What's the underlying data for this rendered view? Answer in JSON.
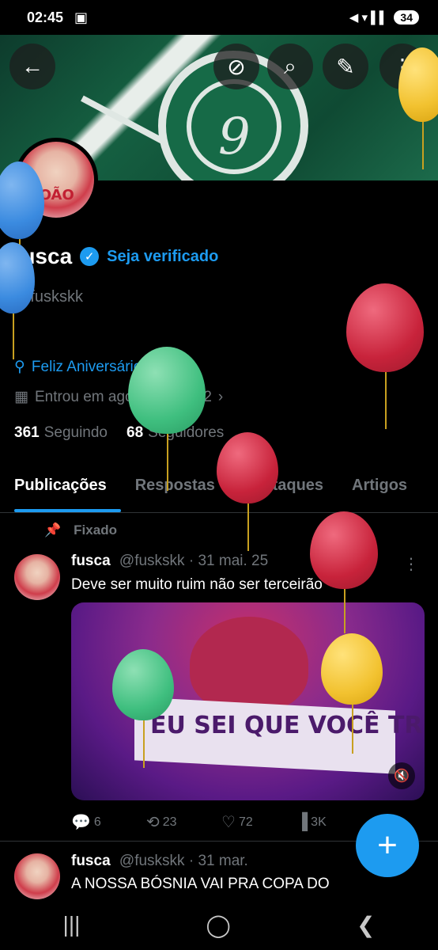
{
  "status_bar": {
    "time": "02:45",
    "battery": "34",
    "signal_icons": "◀ ▾ ▌▌"
  },
  "header": {
    "back_icon": "arrow-left-icon",
    "crest_mark": "9",
    "buttons": [
      {
        "name": "grok-icon",
        "glyph": "⊘"
      },
      {
        "name": "search-icon",
        "glyph": "⌕"
      },
      {
        "name": "edit-icon",
        "glyph": "✎"
      },
      {
        "name": "more-icon",
        "glyph": "⋮"
      }
    ]
  },
  "profile": {
    "avatar_text": "JOÃO",
    "name": "fusca",
    "verified_icon": "✓",
    "verify_link": "Seja verificado",
    "handle": "@fuskskk",
    "bio_link": "Feliz Aniversário!",
    "joined": "Entrou em agosto de 2022",
    "following_count": "361",
    "following_label": "Seguindo",
    "followers_count": "68",
    "followers_label": "Seguidores"
  },
  "tabs": [
    "Publicações",
    "Respostas",
    "Destaques",
    "Artigos"
  ],
  "feed": {
    "pinned_label": "Fixado",
    "posts": [
      {
        "name": "fusca",
        "handle": "@fuskskk",
        "date": "· 31 mai. 25",
        "text": "Deve ser muito ruim não ser terceirão",
        "media_text": "EU SEI QUE VOCÊ TREME",
        "replies": "6",
        "reposts": "23",
        "likes": "72",
        "views": "3K"
      },
      {
        "name": "fusca",
        "handle": "@fuskskk",
        "date": "· 31 mar.",
        "text": "A NOSSA BÓSNIA VAI PRA COPA DO"
      }
    ]
  },
  "fab_label": "+",
  "nav": [
    "|||",
    "◯",
    "❮"
  ],
  "colors": {
    "accent": "#1d9bf0",
    "background": "#000000",
    "balloon_red": "#c8233b",
    "balloon_green": "#3fbf7f",
    "balloon_yellow": "#f2c230",
    "balloon_blue": "#3b8be0"
  }
}
